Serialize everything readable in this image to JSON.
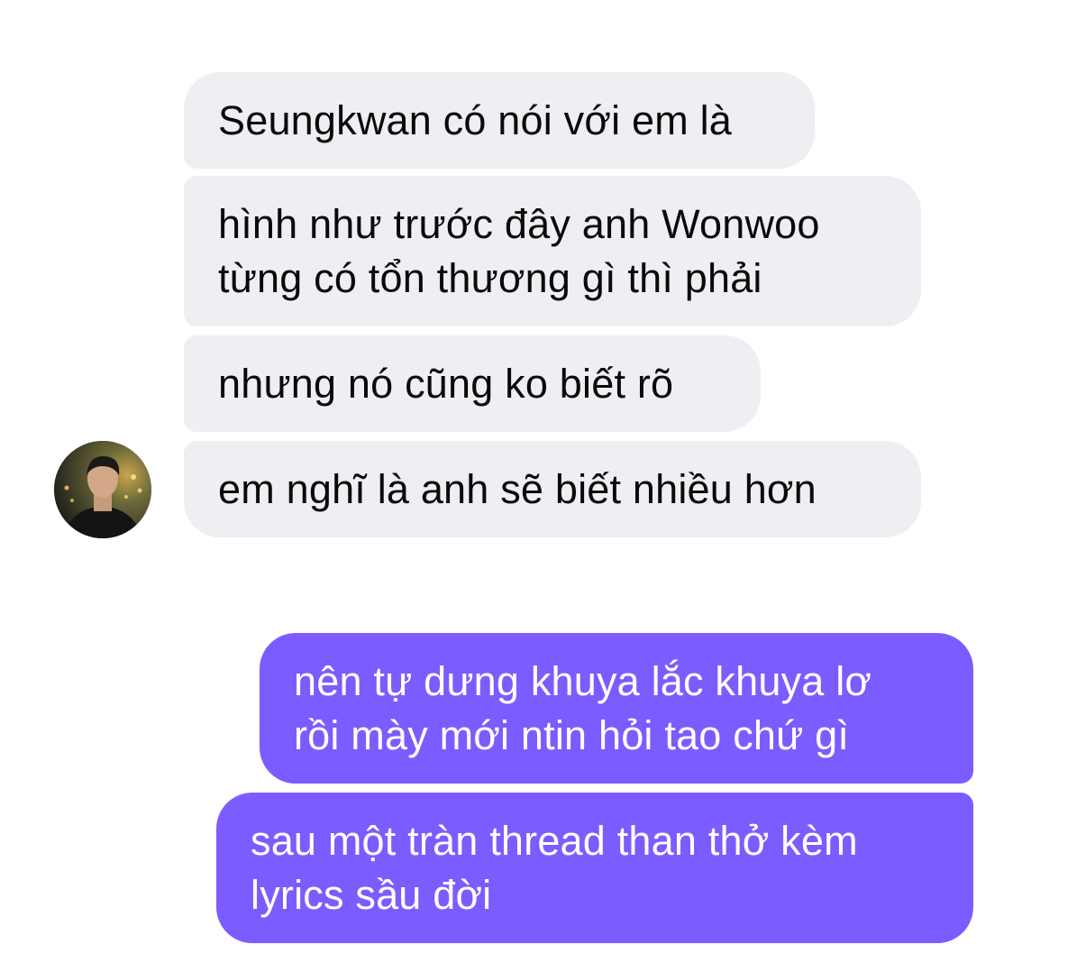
{
  "conversation": {
    "incoming": [
      {
        "lines": [
          "Seungkwan có nói với em là"
        ]
      },
      {
        "lines": [
          "hình như trước đây anh Wonwoo",
          "từng có tổn thương gì thì phải"
        ]
      },
      {
        "lines": [
          "nhưng nó cũng ko biết rõ"
        ]
      },
      {
        "lines": [
          "em nghĩ là anh sẽ biết nhiều hơn"
        ]
      }
    ],
    "outgoing": [
      {
        "lines": [
          "nên tự dưng khuya lắc khuya lơ",
          "rồi mày mới ntin hỏi tao chứ gì"
        ]
      },
      {
        "lines": [
          "sau một tràn thread than thở kèm",
          "lyrics sầu đời"
        ]
      }
    ]
  },
  "colors": {
    "incoming_bubble": "#efeef2",
    "outgoing_bubble": "#7c5cff",
    "incoming_text": "#0a0a0a",
    "outgoing_text": "#ffffff"
  },
  "icons": {
    "avatar": "contact-avatar-photo"
  }
}
